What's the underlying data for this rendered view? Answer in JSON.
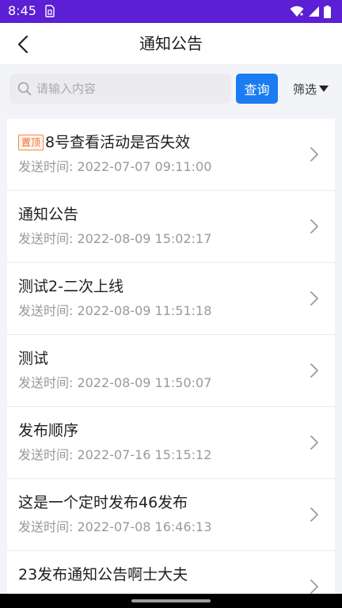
{
  "status_bar": {
    "time": "8:45",
    "icons": [
      "sim-card-icon",
      "wifi-icon",
      "signal-icon",
      "battery-icon"
    ]
  },
  "header": {
    "title": "通知公告",
    "back_icon": "chevron-left-icon"
  },
  "search": {
    "placeholder": "请输入内容",
    "value": "",
    "button_label": "查询",
    "filter_label": "筛选",
    "search_icon": "search-icon",
    "filter_icon": "caret-down-icon"
  },
  "list": {
    "time_prefix": "发送时间: ",
    "items": [
      {
        "pinned": true,
        "badge": "置顶",
        "title": "8号查看活动是否失效",
        "time": "2022-07-07 09:11:00"
      },
      {
        "pinned": false,
        "badge": "",
        "title": "通知公告",
        "time": "2022-08-09 15:02:17"
      },
      {
        "pinned": false,
        "badge": "",
        "title": "测试2-二次上线",
        "time": "2022-08-09 11:51:18"
      },
      {
        "pinned": false,
        "badge": "",
        "title": "测试",
        "time": "2022-08-09 11:50:07"
      },
      {
        "pinned": false,
        "badge": "",
        "title": "发布顺序",
        "time": "2022-07-16 15:15:12"
      },
      {
        "pinned": false,
        "badge": "",
        "title": "这是一个定时发布46发布",
        "time": "2022-07-08 16:46:13"
      },
      {
        "pinned": false,
        "badge": "",
        "title": "23发布通知公告啊士大夫",
        "time": ""
      }
    ]
  },
  "colors": {
    "status_bar": "#5b1fd4",
    "primary": "#1a7cf0",
    "pin_badge": "#f06a2a",
    "secondary_text": "#9a9a9a"
  }
}
